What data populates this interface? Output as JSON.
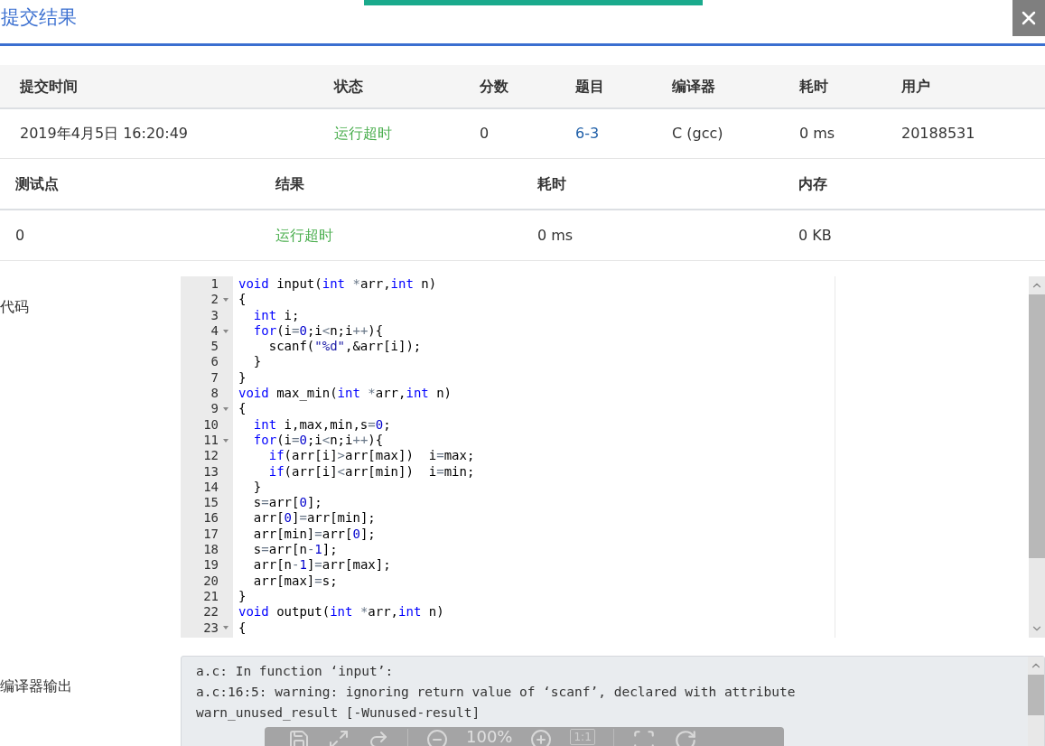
{
  "dialog": {
    "title": "提交结果"
  },
  "summary_table": {
    "columns": [
      "提交时间",
      "状态",
      "分数",
      "题目",
      "编译器",
      "耗时",
      "用户"
    ],
    "rows": [
      {
        "cells": [
          {
            "kind": "text",
            "text": "2019年4月5日 16:20:49"
          },
          {
            "kind": "status",
            "text": "运行超时"
          },
          {
            "kind": "text",
            "text": "0"
          },
          {
            "kind": "link",
            "text": "6-3"
          },
          {
            "kind": "text",
            "text": "C (gcc)"
          },
          {
            "kind": "text",
            "text": "0 ms"
          },
          {
            "kind": "text",
            "text": "20188531"
          }
        ]
      }
    ]
  },
  "testcase_table": {
    "columns": [
      "测试点",
      "结果",
      "耗时",
      "内存"
    ],
    "rows": [
      {
        "cells": [
          {
            "kind": "text",
            "text": "0"
          },
          {
            "kind": "status",
            "text": "运行超时"
          },
          {
            "kind": "text",
            "text": "0 ms"
          },
          {
            "kind": "text",
            "text": "0 KB"
          }
        ]
      }
    ]
  },
  "code": {
    "label": "代码",
    "lines": [
      {
        "no": "1",
        "fold": false,
        "tokens": [
          {
            "kind": "keyword",
            "text": "void"
          },
          {
            "kind": "plain",
            "text": " input("
          },
          {
            "kind": "keyword",
            "text": "int"
          },
          {
            "kind": "operator",
            "text": " *"
          },
          {
            "kind": "plain",
            "text": "arr,"
          },
          {
            "kind": "keyword",
            "text": "int"
          },
          {
            "kind": "plain",
            "text": " n)"
          }
        ]
      },
      {
        "no": "2",
        "fold": true,
        "tokens": [
          {
            "kind": "plain",
            "text": "{"
          }
        ]
      },
      {
        "no": "3",
        "fold": false,
        "tokens": [
          {
            "kind": "keyword",
            "text": "  int"
          },
          {
            "kind": "plain",
            "text": " i;"
          }
        ]
      },
      {
        "no": "4",
        "fold": true,
        "tokens": [
          {
            "kind": "keyword",
            "text": "  for"
          },
          {
            "kind": "plain",
            "text": "(i"
          },
          {
            "kind": "operator",
            "text": "="
          },
          {
            "kind": "number",
            "text": "0"
          },
          {
            "kind": "plain",
            "text": ";i"
          },
          {
            "kind": "operator",
            "text": "<"
          },
          {
            "kind": "plain",
            "text": "n;i"
          },
          {
            "kind": "operator",
            "text": "++"
          },
          {
            "kind": "plain",
            "text": "){"
          }
        ]
      },
      {
        "no": "5",
        "fold": false,
        "tokens": [
          {
            "kind": "plain",
            "text": "    scanf("
          },
          {
            "kind": "string",
            "text": "\"%d\""
          },
          {
            "kind": "plain",
            "text": ",&arr[i]);"
          }
        ]
      },
      {
        "no": "6",
        "fold": false,
        "tokens": [
          {
            "kind": "plain",
            "text": "  }"
          }
        ]
      },
      {
        "no": "7",
        "fold": false,
        "tokens": [
          {
            "kind": "plain",
            "text": "}"
          }
        ]
      },
      {
        "no": "8",
        "fold": false,
        "tokens": [
          {
            "kind": "keyword",
            "text": "void"
          },
          {
            "kind": "plain",
            "text": " max_min("
          },
          {
            "kind": "keyword",
            "text": "int"
          },
          {
            "kind": "operator",
            "text": " *"
          },
          {
            "kind": "plain",
            "text": "arr,"
          },
          {
            "kind": "keyword",
            "text": "int"
          },
          {
            "kind": "plain",
            "text": " n)"
          }
        ]
      },
      {
        "no": "9",
        "fold": true,
        "tokens": [
          {
            "kind": "plain",
            "text": "{"
          }
        ]
      },
      {
        "no": "10",
        "fold": false,
        "tokens": [
          {
            "kind": "keyword",
            "text": "  int"
          },
          {
            "kind": "plain",
            "text": " i,max,min,s"
          },
          {
            "kind": "operator",
            "text": "="
          },
          {
            "kind": "number",
            "text": "0"
          },
          {
            "kind": "plain",
            "text": ";"
          }
        ]
      },
      {
        "no": "11",
        "fold": true,
        "tokens": [
          {
            "kind": "keyword",
            "text": "  for"
          },
          {
            "kind": "plain",
            "text": "(i"
          },
          {
            "kind": "operator",
            "text": "="
          },
          {
            "kind": "number",
            "text": "0"
          },
          {
            "kind": "plain",
            "text": ";i"
          },
          {
            "kind": "operator",
            "text": "<"
          },
          {
            "kind": "plain",
            "text": "n;i"
          },
          {
            "kind": "operator",
            "text": "++"
          },
          {
            "kind": "plain",
            "text": "){"
          }
        ]
      },
      {
        "no": "12",
        "fold": false,
        "tokens": [
          {
            "kind": "keyword",
            "text": "    if"
          },
          {
            "kind": "plain",
            "text": "(arr[i]"
          },
          {
            "kind": "operator",
            "text": ">"
          },
          {
            "kind": "plain",
            "text": "arr[max])  i"
          },
          {
            "kind": "operator",
            "text": "="
          },
          {
            "kind": "plain",
            "text": "max;"
          }
        ]
      },
      {
        "no": "13",
        "fold": false,
        "tokens": [
          {
            "kind": "keyword",
            "text": "    if"
          },
          {
            "kind": "plain",
            "text": "(arr[i]"
          },
          {
            "kind": "operator",
            "text": "<"
          },
          {
            "kind": "plain",
            "text": "arr[min])  i"
          },
          {
            "kind": "operator",
            "text": "="
          },
          {
            "kind": "plain",
            "text": "min;"
          }
        ]
      },
      {
        "no": "14",
        "fold": false,
        "tokens": [
          {
            "kind": "plain",
            "text": "  }"
          }
        ]
      },
      {
        "no": "15",
        "fold": false,
        "tokens": [
          {
            "kind": "plain",
            "text": "  s"
          },
          {
            "kind": "operator",
            "text": "="
          },
          {
            "kind": "plain",
            "text": "arr["
          },
          {
            "kind": "number",
            "text": "0"
          },
          {
            "kind": "plain",
            "text": "];"
          }
        ]
      },
      {
        "no": "16",
        "fold": false,
        "tokens": [
          {
            "kind": "plain",
            "text": "  arr["
          },
          {
            "kind": "number",
            "text": "0"
          },
          {
            "kind": "plain",
            "text": "]"
          },
          {
            "kind": "operator",
            "text": "="
          },
          {
            "kind": "plain",
            "text": "arr[min];"
          }
        ]
      },
      {
        "no": "17",
        "fold": false,
        "tokens": [
          {
            "kind": "plain",
            "text": "  arr[min]"
          },
          {
            "kind": "operator",
            "text": "="
          },
          {
            "kind": "plain",
            "text": "arr["
          },
          {
            "kind": "number",
            "text": "0"
          },
          {
            "kind": "plain",
            "text": "];"
          }
        ]
      },
      {
        "no": "18",
        "fold": false,
        "tokens": [
          {
            "kind": "plain",
            "text": "  s"
          },
          {
            "kind": "operator",
            "text": "="
          },
          {
            "kind": "plain",
            "text": "arr[n"
          },
          {
            "kind": "operator",
            "text": "-"
          },
          {
            "kind": "number",
            "text": "1"
          },
          {
            "kind": "plain",
            "text": "];"
          }
        ]
      },
      {
        "no": "19",
        "fold": false,
        "tokens": [
          {
            "kind": "plain",
            "text": "  arr[n"
          },
          {
            "kind": "operator",
            "text": "-"
          },
          {
            "kind": "number",
            "text": "1"
          },
          {
            "kind": "plain",
            "text": "]"
          },
          {
            "kind": "operator",
            "text": "="
          },
          {
            "kind": "plain",
            "text": "arr[max];"
          }
        ]
      },
      {
        "no": "20",
        "fold": false,
        "tokens": [
          {
            "kind": "plain",
            "text": "  arr[max]"
          },
          {
            "kind": "operator",
            "text": "="
          },
          {
            "kind": "plain",
            "text": "s;"
          }
        ]
      },
      {
        "no": "21",
        "fold": false,
        "tokens": [
          {
            "kind": "plain",
            "text": "}"
          }
        ]
      },
      {
        "no": "22",
        "fold": false,
        "tokens": [
          {
            "kind": "keyword",
            "text": "void"
          },
          {
            "kind": "plain",
            "text": " output("
          },
          {
            "kind": "keyword",
            "text": "int"
          },
          {
            "kind": "operator",
            "text": " *"
          },
          {
            "kind": "plain",
            "text": "arr,"
          },
          {
            "kind": "keyword",
            "text": "int"
          },
          {
            "kind": "plain",
            "text": " n)"
          }
        ]
      },
      {
        "no": "23",
        "fold": true,
        "tokens": [
          {
            "kind": "plain",
            "text": "{"
          }
        ]
      }
    ]
  },
  "compiler_output": {
    "label": "编译器输出",
    "lines": [
      "a.c: In function ‘input’:",
      "a.c:16:5: warning: ignoring return value of ‘scanf’, declared with attribute",
      "warn_unused_result [-Wunused-result]"
    ]
  },
  "image_toolbar": {
    "zoom": "100%",
    "actual_size": "1:1"
  }
}
